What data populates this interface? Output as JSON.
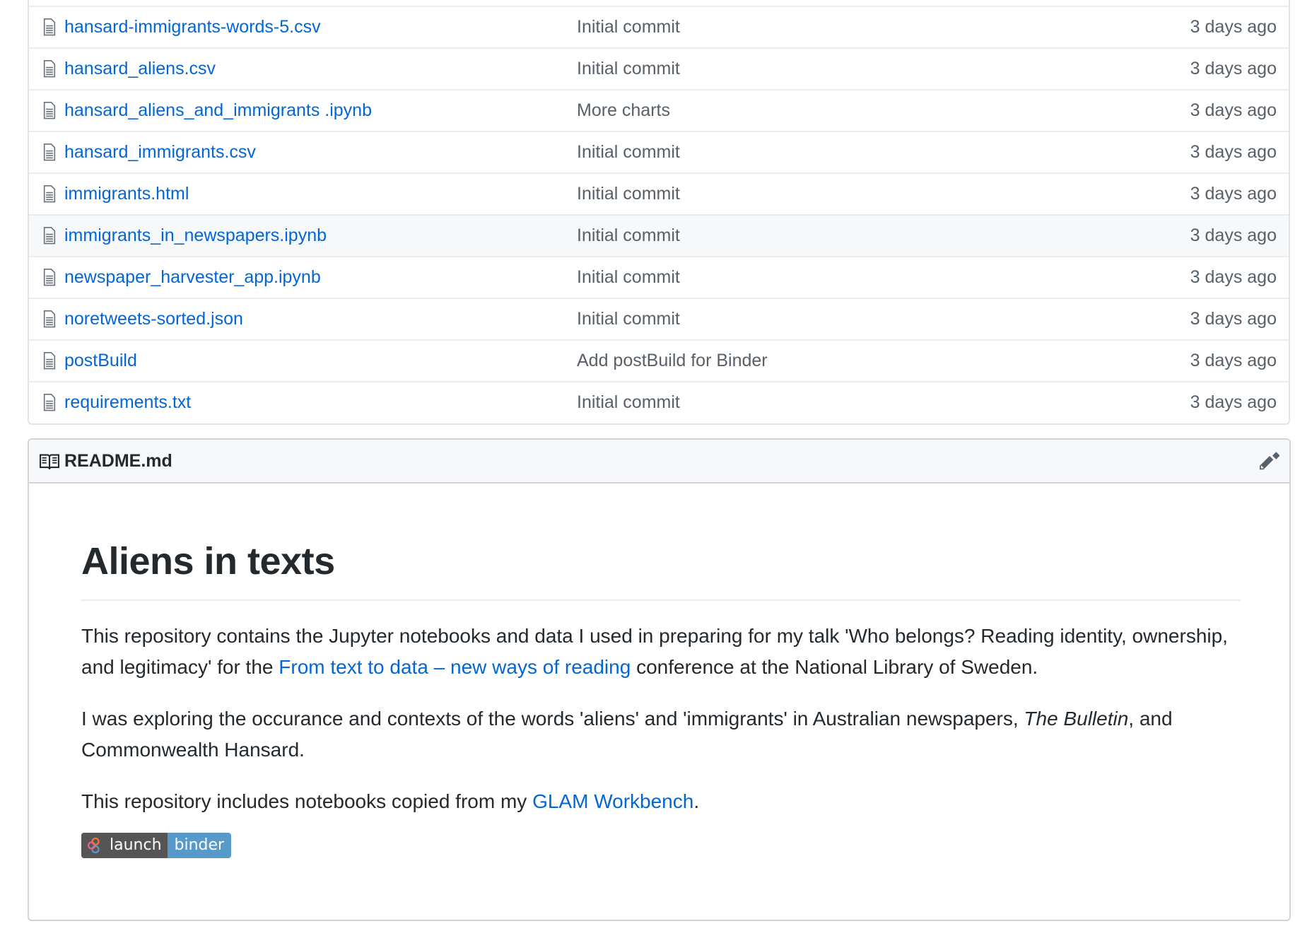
{
  "files": [
    {
      "name": "hansard-immigrants-words-5.csv",
      "message": "Initial commit",
      "age": "3 days ago"
    },
    {
      "name": "hansard_aliens.csv",
      "message": "Initial commit",
      "age": "3 days ago"
    },
    {
      "name": "hansard_aliens_and_immigrants .ipynb",
      "message": "More charts",
      "age": "3 days ago"
    },
    {
      "name": "hansard_immigrants.csv",
      "message": "Initial commit",
      "age": "3 days ago"
    },
    {
      "name": "immigrants.html",
      "message": "Initial commit",
      "age": "3 days ago"
    },
    {
      "name": "immigrants_in_newspapers.ipynb",
      "message": "Initial commit",
      "age": "3 days ago"
    },
    {
      "name": "newspaper_harvester_app.ipynb",
      "message": "Initial commit",
      "age": "3 days ago"
    },
    {
      "name": "noretweets-sorted.json",
      "message": "Initial commit",
      "age": "3 days ago"
    },
    {
      "name": "postBuild",
      "message": "Add postBuild for Binder",
      "age": "3 days ago"
    },
    {
      "name": "requirements.txt",
      "message": "Initial commit",
      "age": "3 days ago"
    }
  ],
  "readme": {
    "filename": "README.md",
    "heading": "Aliens in texts",
    "p1_before": "This repository contains the Jupyter notebooks and data I used in preparing for my talk 'Who belongs? Reading identity, ownership, and legitimacy' for the ",
    "p1_link": "From text to data – new ways of reading",
    "p1_after": " conference at the National Library of Sweden.",
    "p2_before": "I was exploring the occurance and contexts of the words 'aliens' and 'immigrants' in Australian newspapers, ",
    "p2_italic": "The Bulletin",
    "p2_after": ", and Commonwealth Hansard.",
    "p3_before": "This repository includes notebooks copied from my ",
    "p3_link": "GLAM Workbench",
    "p3_after": ".",
    "badge_left": "launch",
    "badge_right": "binder"
  },
  "colors": {
    "link": "#0366d6",
    "muted": "#586069",
    "badge_left": "#555555",
    "badge_right": "#579aca"
  },
  "icons": {
    "file": "file-icon",
    "readme": "book-icon",
    "edit": "pencil-icon",
    "badge": "binder-logo-icon"
  }
}
